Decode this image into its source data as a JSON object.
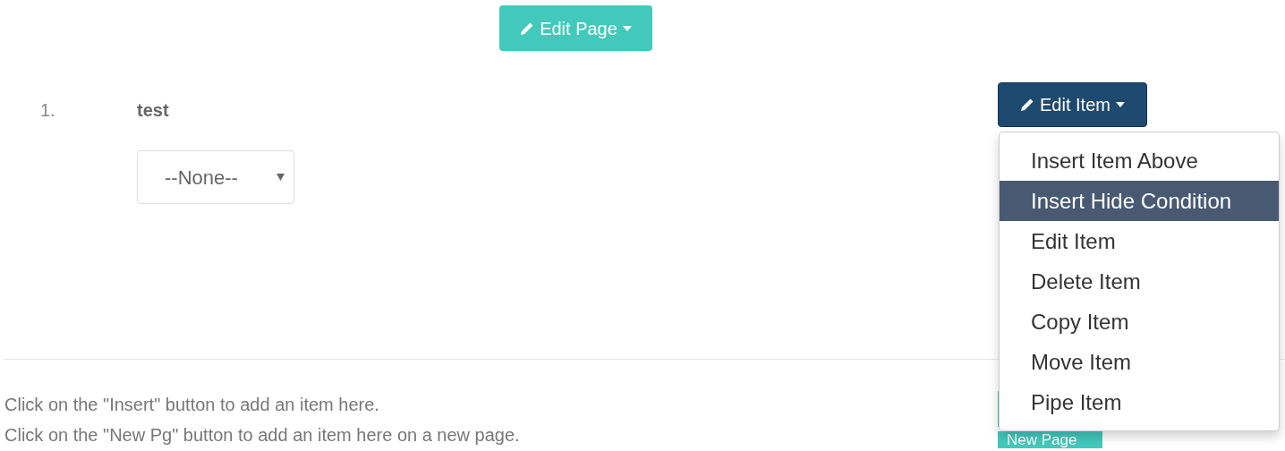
{
  "edit_page_button": {
    "label": "Edit Page"
  },
  "item": {
    "number": "1.",
    "title": "test",
    "select": {
      "value": "--None--"
    }
  },
  "edit_item_button": {
    "label": "Edit Item",
    "expanded": true
  },
  "edit_item_menu": [
    {
      "label": "Insert Item Above",
      "selected": false
    },
    {
      "label": "Insert Hide Condition",
      "selected": true
    },
    {
      "label": "Edit Item",
      "selected": false
    },
    {
      "label": "Delete Item",
      "selected": false
    },
    {
      "label": "Copy Item",
      "selected": false
    },
    {
      "label": "Move Item",
      "selected": false
    },
    {
      "label": "Pipe Item",
      "selected": false
    }
  ],
  "hints": [
    "Click on the \"Insert\" button to add an item here.",
    "Click on the \"New Pg\" button to add an item here on a new page."
  ],
  "new_page_button": {
    "label": "New Page"
  }
}
